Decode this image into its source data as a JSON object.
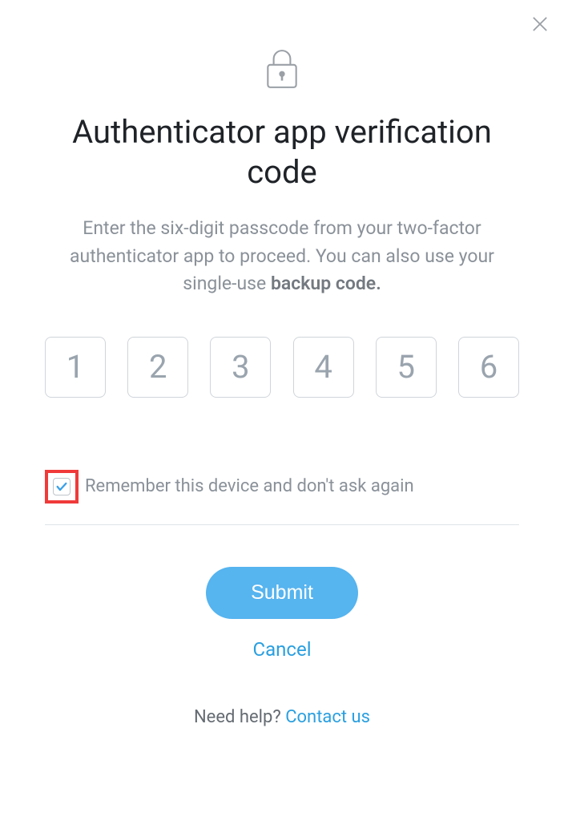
{
  "title": "Authenticator app verification code",
  "description_prefix": "Enter the six-digit passcode from your two-factor authenticator app to proceed. You can also use your single-use ",
  "backup_code_text": "backup code.",
  "code_placeholders": [
    "1",
    "2",
    "3",
    "4",
    "5",
    "6"
  ],
  "remember_label": "Remember this device and don't ask again",
  "remember_checked": true,
  "submit_label": "Submit",
  "cancel_label": "Cancel",
  "help_prefix": "Need help? ",
  "contact_label": "Contact us"
}
